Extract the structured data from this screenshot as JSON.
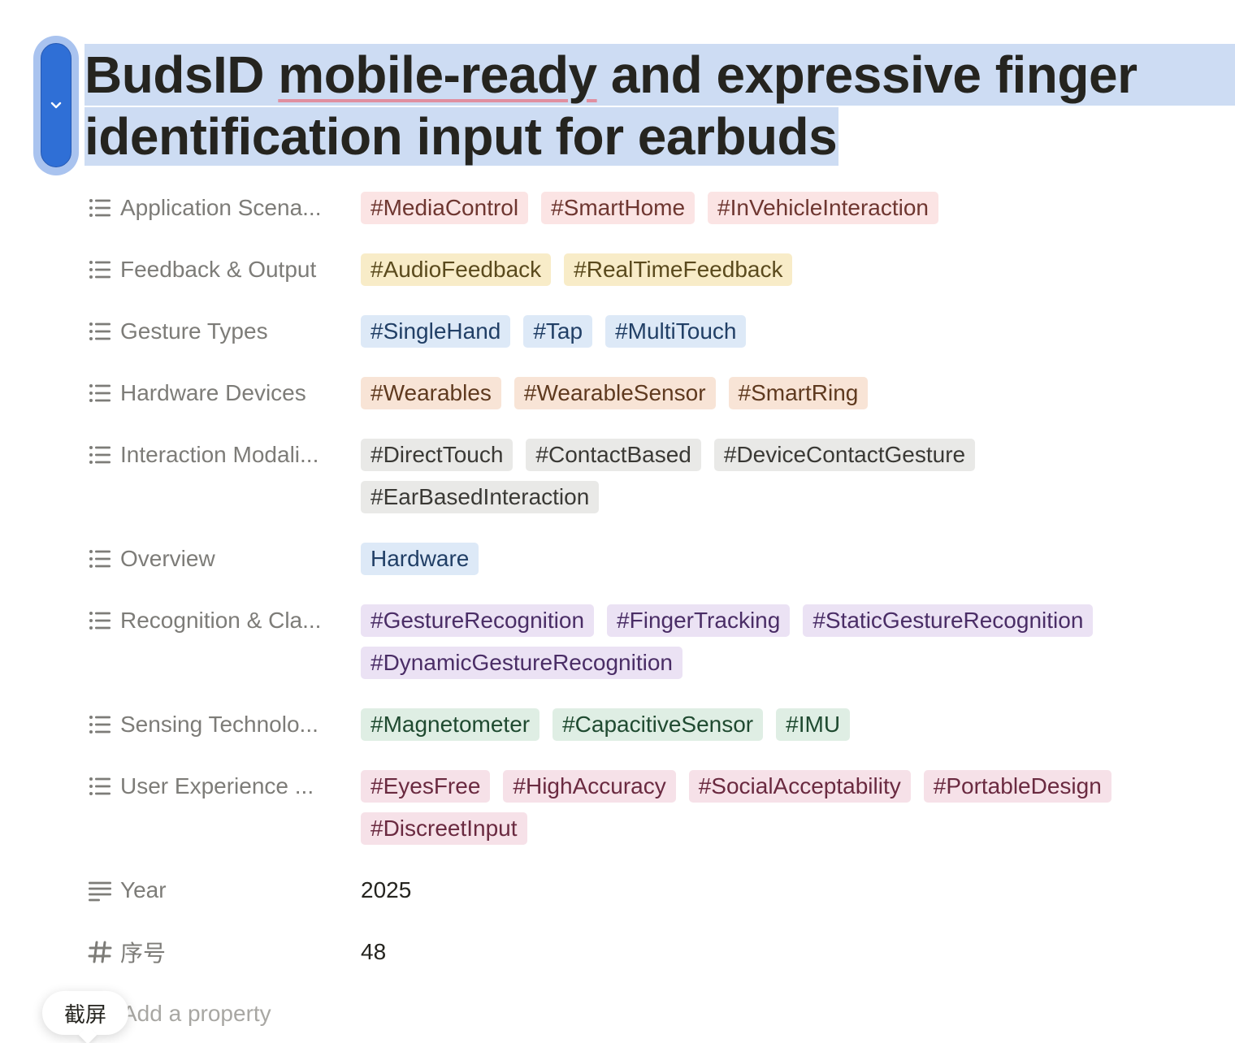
{
  "title": {
    "word1": "BudsID",
    "word2": "mobile-ready",
    "rest1": "and expressive finger",
    "line2": "identification input for earbuds"
  },
  "properties": [
    {
      "key": "application",
      "label": "Application Scena...",
      "icon": "list-icon",
      "tags": [
        "#MediaControl",
        "#SmartHome",
        "#InVehicleInteraction"
      ],
      "bg": "#fbe4e4",
      "fg": "#6e3630"
    },
    {
      "key": "feedback",
      "label": "Feedback & Output",
      "icon": "list-icon",
      "tags": [
        "#AudioFeedback",
        "#RealTimeFeedback"
      ],
      "bg": "#f8ecc8",
      "fg": "#5a4a1d"
    },
    {
      "key": "gesture",
      "label": "Gesture Types",
      "icon": "list-icon",
      "tags": [
        "#SingleHand",
        "#Tap",
        "#MultiTouch"
      ],
      "bg": "#dde9f7",
      "fg": "#213f66"
    },
    {
      "key": "hardware",
      "label": "Hardware Devices",
      "icon": "list-icon",
      "tags": [
        "#Wearables",
        "#WearableSensor",
        "#SmartRing"
      ],
      "bg": "#f8e4d6",
      "fg": "#5f3a1f"
    },
    {
      "key": "interaction",
      "label": "Interaction Modali...",
      "icon": "list-icon",
      "tags": [
        "#DirectTouch",
        "#ContactBased",
        "#DeviceContactGesture",
        "#EarBasedInteraction"
      ],
      "bg": "#e9e9e7",
      "fg": "#3a3935"
    },
    {
      "key": "overview",
      "label": "Overview",
      "icon": "list-icon",
      "tags": [
        "Hardware"
      ],
      "bg": "#dde9f7",
      "fg": "#213f66"
    },
    {
      "key": "recognition",
      "label": "Recognition & Cla...",
      "icon": "list-icon",
      "tags": [
        "#GestureRecognition",
        "#FingerTracking",
        "#StaticGestureRecognition",
        "#DynamicGestureRecognition"
      ],
      "bg": "#ebe2f4",
      "fg": "#4a2d66"
    },
    {
      "key": "sensing",
      "label": "Sensing Technolo...",
      "icon": "list-icon",
      "tags": [
        "#Magnetometer",
        "#CapacitiveSensor",
        "#IMU"
      ],
      "bg": "#dfeee4",
      "fg": "#1f4a30"
    },
    {
      "key": "ux",
      "label": "User Experience ...",
      "icon": "list-icon",
      "tags": [
        "#EyesFree",
        "#HighAccuracy",
        "#SocialAcceptability",
        "#PortableDesign",
        "#DiscreetInput"
      ],
      "bg": "#f6e1e8",
      "fg": "#6a2a40"
    }
  ],
  "year": {
    "label": "Year",
    "icon": "text-lines-icon",
    "value": "2025"
  },
  "number": {
    "label": "序号",
    "icon": "hash-icon",
    "value": "48"
  },
  "add_property": "Add a property",
  "screenshot_tooltip": "截屏"
}
